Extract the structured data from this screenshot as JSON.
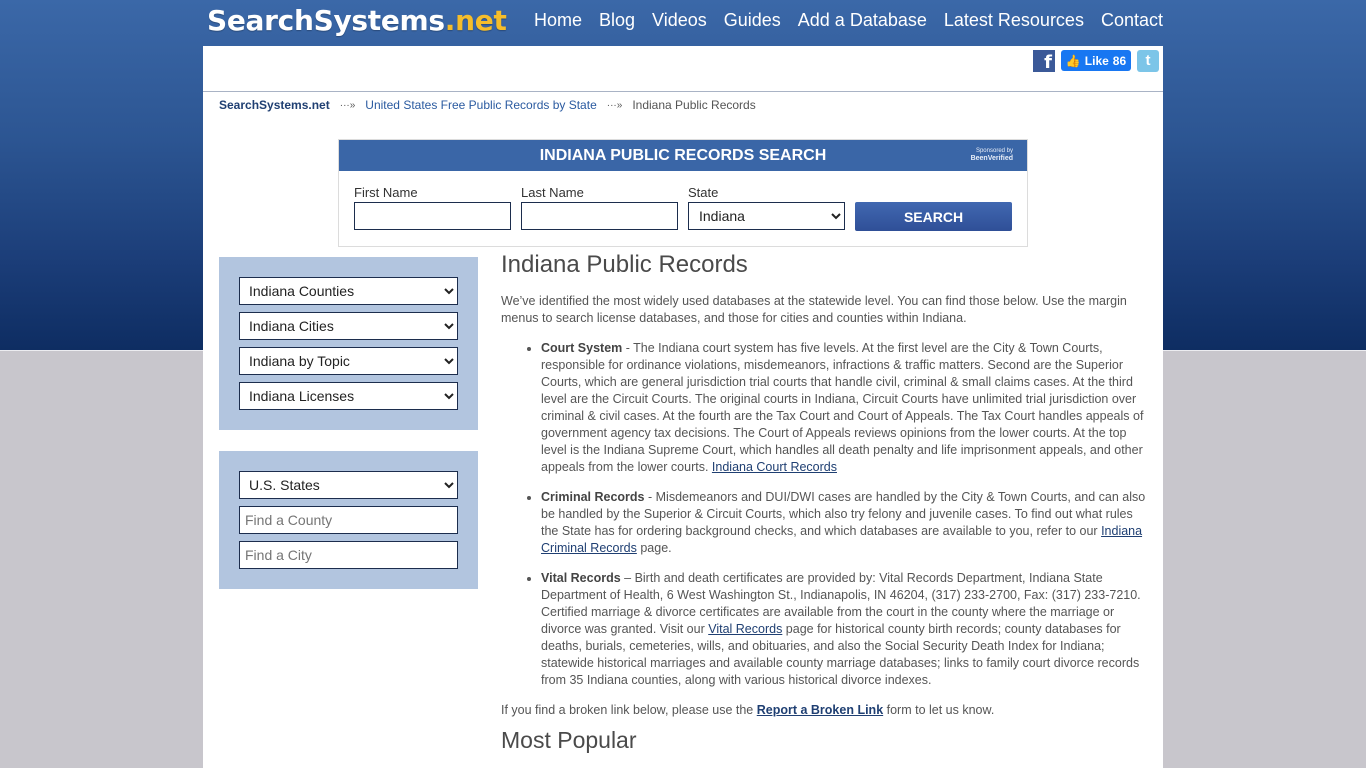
{
  "header": {
    "logo_main": "SearchSystems",
    "logo_tld": ".net",
    "nav": [
      "Home",
      "Blog",
      "Videos",
      "Guides",
      "Add a Database",
      "Latest Resources",
      "Contact"
    ]
  },
  "social": {
    "facebook_icon": "facebook-icon",
    "like_label": "Like",
    "like_count": "86",
    "twitter_icon": "twitter-icon"
  },
  "breadcrumb": {
    "home": "SearchSystems.net",
    "separator": "···»",
    "level1": "United States Free Public Records by State",
    "current": "Indiana Public Records"
  },
  "search": {
    "title": "INDIANA PUBLIC RECORDS SEARCH",
    "sponsor_line1": "Sponsored by",
    "sponsor_line2": "BeenVerified",
    "first_name_label": "First Name",
    "first_name_value": "",
    "last_name_label": "Last Name",
    "last_name_value": "",
    "state_label": "State",
    "state_value": "Indiana",
    "button": "SEARCH"
  },
  "sidebar": {
    "box1": [
      "Indiana Counties",
      "Indiana Cities",
      "Indiana by Topic",
      "Indiana Licenses"
    ],
    "box2": {
      "states_select": "U.S. States",
      "county_placeholder": "Find a County",
      "city_placeholder": "Find a City"
    }
  },
  "main": {
    "title": "Indiana Public Records",
    "intro": "We’ve identified the most widely used databases at the statewide level.  You can find those below.  Use the margin menus to search license databases, and those for cities and counties within Indiana.",
    "items": [
      {
        "heading": "Court System",
        "text": " - The Indiana court system has five levels. At the first level are the City & Town Courts, responsible for ordinance violations, misdemeanors, infractions & traffic matters. Second are the Superior Courts, which are general jurisdiction trial courts that handle civil, criminal & small claims cases. At the third level are the Circuit Courts. The original courts in Indiana, Circuit Courts have unlimited trial jurisdiction over criminal & civil cases. At the fourth are the Tax Court and Court of Appeals. The Tax Court handles appeals of government agency tax decisions. The Court of Appeals reviews opinions from the lower courts. At the top level is the Indiana Supreme Court, which handles all death penalty and life imprisonment appeals, and other appeals from the lower courts.  ",
        "link": "Indiana Court Records",
        "after": ""
      },
      {
        "heading": "Criminal Records",
        "text": " - Misdemeanors and DUI/DWI cases are handled by the City & Town Courts, and can also be handled by the Superior & Circuit Courts, which also try felony and juvenile cases.  To find out what rules the State has for ordering background checks, and which databases are available to you, refer to our ",
        "link": "Indiana Criminal Records",
        "after": " page."
      },
      {
        "heading": "Vital Records",
        "text": " – Birth and death certificates are provided by: Vital Records Department, Indiana State Department of Health, 6 West Washington St., Indianapolis, IN 46204, (317) 233-2700, Fax: (317) 233-7210. Certified marriage & divorce certificates are available from the court in the county where the marriage or divorce was granted.  Visit our ",
        "link": "Vital Records",
        "after": " page for historical county birth records; county databases for deaths, burials, cemeteries, wills, and obituaries, and also the Social Security Death Index for Indiana; statewide historical marriages and available county marriage databases; links to family court divorce records from 35 Indiana counties, along with various historical divorce indexes."
      }
    ],
    "broken_before": "If you find a broken link below, please use the ",
    "broken_link": "Report a Broken Link",
    "broken_after": " form to let us know.",
    "most_popular": "Most Popular"
  }
}
